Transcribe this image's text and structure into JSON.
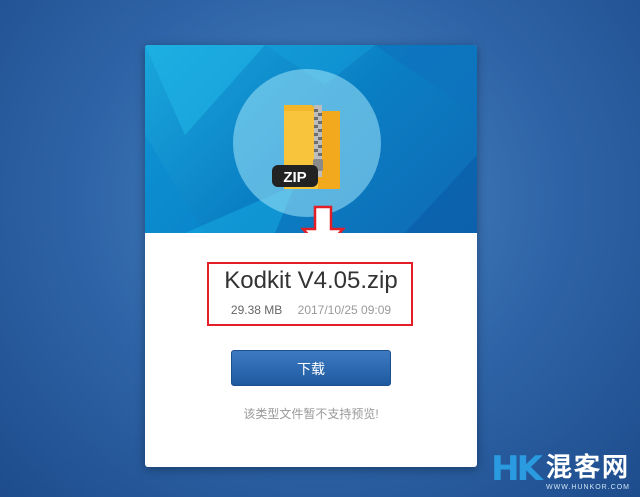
{
  "file": {
    "name": "Kodkit V4.05.zip",
    "size": "29.38 MB",
    "date": "2017/10/25 09:09",
    "icon": "zip-folder-icon",
    "icon_label": "ZIP"
  },
  "download_button": {
    "label": "下载"
  },
  "notice": "该类型文件暂不支持预览!",
  "watermark": {
    "logo": "HK",
    "name": "混客网",
    "url": "WWW.HUNKOR.COM"
  },
  "colors": {
    "highlight": "#e41e26",
    "button": "#2b67ad",
    "banner": "#1a97d4"
  }
}
